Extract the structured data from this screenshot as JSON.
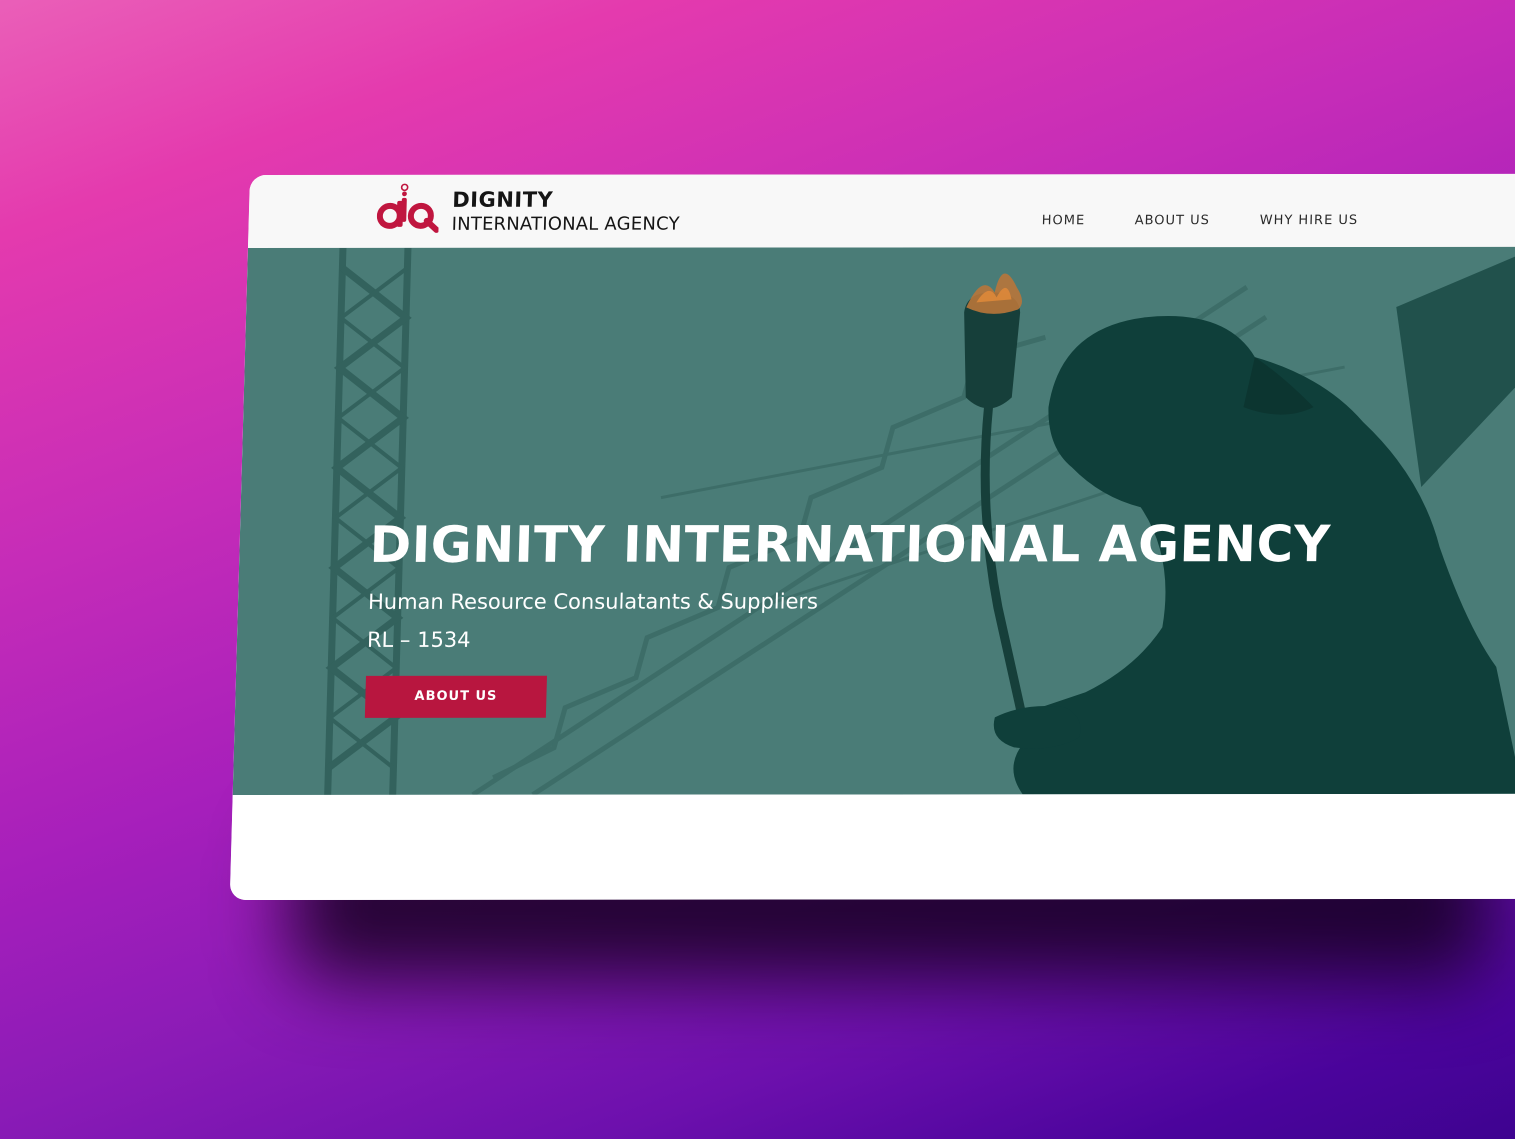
{
  "brand": {
    "line1": "DIGNITY",
    "line2": "INTERNATIONAL AGENCY",
    "logo_icon": "da-monogram-logo",
    "logo_color": "#c0163f"
  },
  "nav": {
    "items": [
      {
        "label": "HOME"
      },
      {
        "label": "ABOUT US"
      },
      {
        "label": "WHY HIRE US"
      }
    ]
  },
  "hero": {
    "title": "DIGNITY INTERNATIONAL AGENCY",
    "subtitle": "Human Resource Consulatants & Suppliers",
    "license": "RL – 1534",
    "button_label": "ABOUT US",
    "button_color": "#b8163f",
    "overlay_color": "#4a7c77"
  }
}
